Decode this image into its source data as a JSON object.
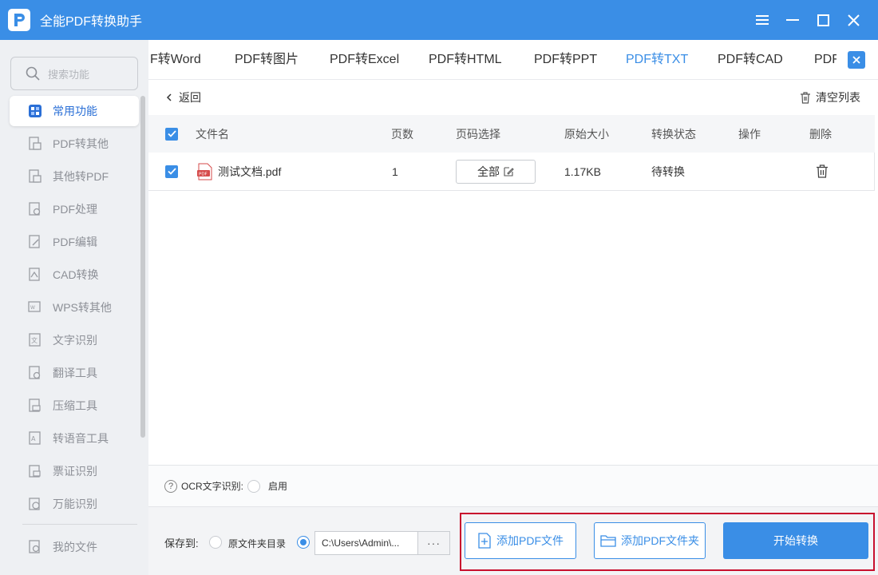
{
  "app": {
    "title": "全能PDF转换助手"
  },
  "window": {
    "controls": [
      "menu-icon",
      "minimize-icon",
      "maximize-icon",
      "close-icon"
    ]
  },
  "sidebar": {
    "search_placeholder": "搜索功能",
    "items": [
      {
        "label": "常用功能",
        "icon": "star-grid-icon",
        "active": true
      },
      {
        "label": "PDF转其他",
        "icon": "pdf-convert-icon"
      },
      {
        "label": "其他转PDF",
        "icon": "to-pdf-icon"
      },
      {
        "label": "PDF处理",
        "icon": "pdf-process-icon"
      },
      {
        "label": "PDF编辑",
        "icon": "pdf-edit-icon"
      },
      {
        "label": "CAD转换",
        "icon": "cad-icon"
      },
      {
        "label": "WPS转其他",
        "icon": "wps-icon"
      },
      {
        "label": "文字识别",
        "icon": "ocr-icon"
      },
      {
        "label": "翻译工具",
        "icon": "translate-icon"
      },
      {
        "label": "压缩工具",
        "icon": "compress-icon"
      },
      {
        "label": "转语音工具",
        "icon": "voice-icon"
      },
      {
        "label": "票证识别",
        "icon": "ticket-icon"
      },
      {
        "label": "万能识别",
        "icon": "universal-ocr-icon"
      }
    ],
    "my_files": "我的文件"
  },
  "tabs": [
    {
      "label": "F转Word"
    },
    {
      "label": "PDF转图片"
    },
    {
      "label": "PDF转Excel"
    },
    {
      "label": "PDF转HTML"
    },
    {
      "label": "PDF转PPT"
    },
    {
      "label": "PDF转TXT",
      "active": true
    },
    {
      "label": "PDF转CAD"
    },
    {
      "label": "PDF"
    }
  ],
  "toolbar": {
    "back": "返回",
    "clear_list": "清空列表"
  },
  "table": {
    "columns": [
      "文件名",
      "页数",
      "页码选择",
      "原始大小",
      "转换状态",
      "操作",
      "删除"
    ],
    "rows": [
      {
        "filename": "测试文档.pdf",
        "pages": "1",
        "page_select": "全部",
        "size": "1.17KB",
        "status": "待转换",
        "action": ""
      }
    ]
  },
  "ocr": {
    "label": "OCR文字识别:",
    "option": "启用"
  },
  "save": {
    "label": "保存到:",
    "option_source": "原文件夹目录",
    "path": "C:\\Users\\Admin\\...",
    "more": "···"
  },
  "buttons": {
    "add_file": "添加PDF文件",
    "add_folder": "添加PDF文件夹",
    "start": "开始转换"
  },
  "colors": {
    "accent": "#3a8ee6",
    "highlight_frame": "#c8102e",
    "sidebar_bg": "#eef0f3"
  }
}
